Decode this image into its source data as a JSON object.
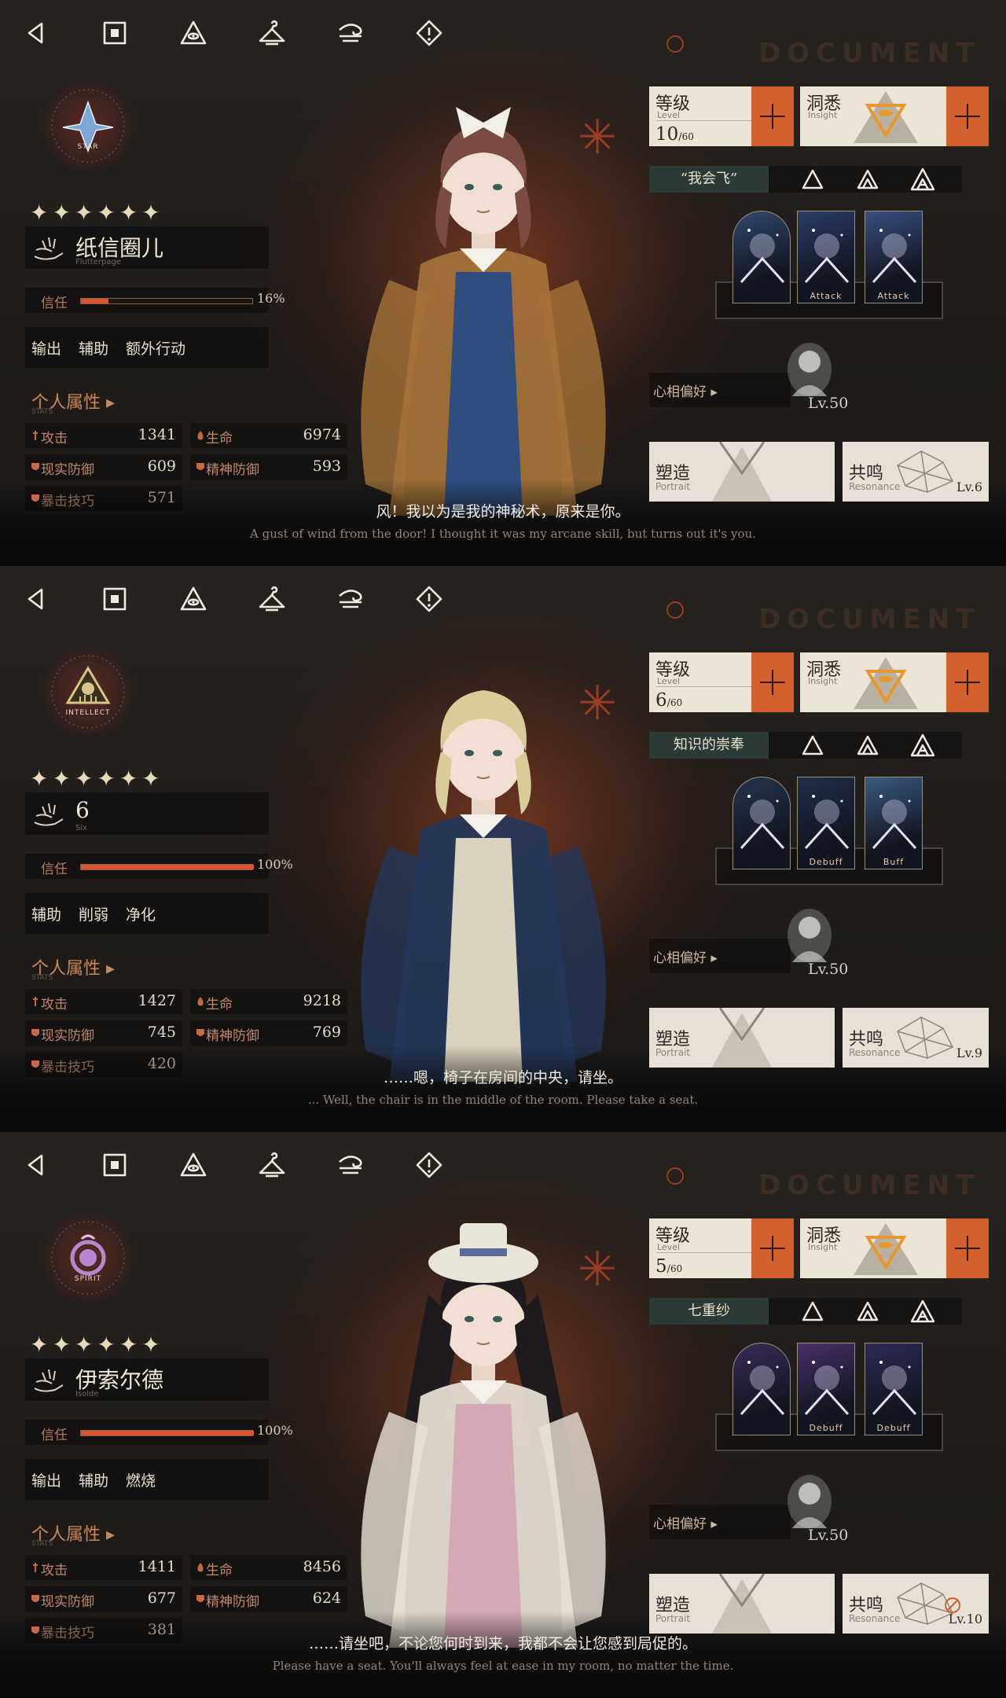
{
  "watermark": "DOCUMENT",
  "nav": [
    {
      "icon": "back-icon"
    },
    {
      "icon": "home-square-icon"
    },
    {
      "icon": "eye-triangle-icon"
    },
    {
      "icon": "hanger-icon"
    },
    {
      "icon": "wind-swirl-icon"
    },
    {
      "icon": "warning-icon"
    }
  ],
  "labels": {
    "trust": "信任",
    "attr_title": "个人属性 ▸",
    "attr_sub": "STATS",
    "level_title": "等级",
    "level_sub": "Level",
    "insight_title": "洞悉",
    "insight_sub": "Insight",
    "pref": "心相偏好 ▸",
    "portrait_title": "塑造",
    "portrait_sub": "Portrait",
    "resonance_title": "共鸣",
    "resonance_sub": "Resonance",
    "atk": "攻击",
    "hp": "生命",
    "rdef": "现实防御",
    "mdef": "精神防御",
    "tech": "暴击技巧"
  },
  "panels": [
    {
      "afflatus": "STAR",
      "afflatus_color": "#7fa7d6",
      "stars": "✦✦✦✦✦✦",
      "name": "纸信圈儿",
      "name_en": "Flutterpage",
      "trust_value": "16%",
      "trust_fraction": 0.16,
      "tags": [
        "输出",
        "辅助",
        "额外行动"
      ],
      "stats": {
        "atk": "1341",
        "hp": "6974",
        "rdef": "609",
        "mdef": "593",
        "tech": "571"
      },
      "level": "10",
      "level_max": "60",
      "motto": "“我会飞”",
      "card_labels": [
        "",
        "Attack",
        "Attack"
      ],
      "card_colors": [
        "#31486e",
        "#2b3c6a",
        "#394e83"
      ],
      "pref_level": "Lv.50",
      "resonance_level": "Lv.6",
      "subtitle_cn": "风！我以为是我的神秘术，原来是你。",
      "subtitle_en": "A gust of wind from the door! I thought it was my arcane skill, but turns out it's you.",
      "hair": "#7a4a43",
      "coat": "#a5733a",
      "dress": "#2f4d7f"
    },
    {
      "afflatus": "INTELLECT",
      "afflatus_color": "#d8c48a",
      "stars": "✦✦✦✦✦✦",
      "name": "6",
      "name_en": "Six",
      "trust_value": "100%",
      "trust_fraction": 1.0,
      "tags": [
        "辅助",
        "削弱",
        "净化"
      ],
      "stats": {
        "atk": "1427",
        "hp": "9218",
        "rdef": "745",
        "mdef": "769",
        "tech": "420"
      },
      "level": "6",
      "level_max": "60",
      "motto": "知识的崇奉",
      "card_labels": [
        "",
        "Debuff",
        "Buff"
      ],
      "card_colors": [
        "#25354e",
        "#1f2e4a",
        "#3a5a82"
      ],
      "pref_level": "Lv.50",
      "resonance_level": "Lv.9",
      "subtitle_cn": "……嗯，椅子在房间的中央，请坐。",
      "subtitle_en": "... Well, the chair is in the middle of the room. Please take a seat.",
      "hair": "#d9cb9a",
      "coat": "#24375a",
      "dress": "#d9d2bf"
    },
    {
      "afflatus": "SPIRIT",
      "afflatus_color": "#b788d2",
      "stars": "✦✦✦✦✦✦",
      "name": "伊索尔德",
      "name_en": "Isolde",
      "trust_value": "100%",
      "trust_fraction": 1.0,
      "tags": [
        "输出",
        "辅助",
        "燃烧"
      ],
      "stats": {
        "atk": "1411",
        "hp": "8456",
        "rdef": "677",
        "mdef": "624",
        "tech": "381"
      },
      "level": "5",
      "level_max": "60",
      "motto": "七重纱",
      "card_labels": [
        "",
        "Debuff",
        "Debuff"
      ],
      "card_colors": [
        "#3a2b58",
        "#48306a",
        "#2d2a55"
      ],
      "pref_level": "Lv.50",
      "resonance_level": "Lv.10",
      "subtitle_cn": "……请坐吧，不论您何时到来，我都不会让您感到局促的。",
      "subtitle_en": "Please have a seat. You'll always feel at ease in my room, no matter the time.",
      "hair": "#1f1a1d",
      "coat": "#e8e2d6",
      "dress": "#d5a8b6"
    }
  ]
}
